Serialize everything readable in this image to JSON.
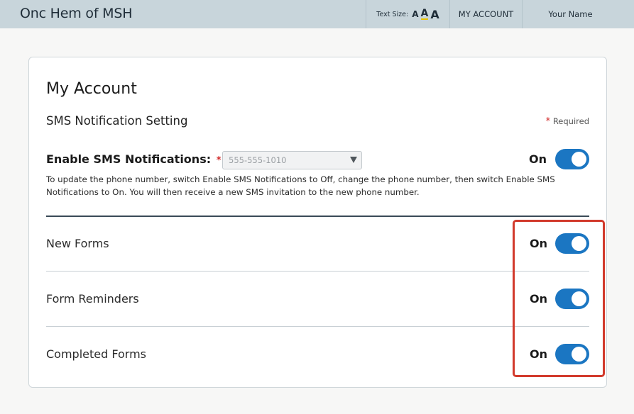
{
  "header": {
    "app_title": "Onc Hem of MSH",
    "text_size_label": "Text Size:",
    "text_size_small": "A",
    "text_size_medium": "A",
    "text_size_large": "A",
    "my_account": "MY ACCOUNT",
    "user_name": "Your Name"
  },
  "page": {
    "title": "My Account",
    "section_title": "SMS Notification Setting",
    "required_star": "*",
    "required_label": "Required"
  },
  "sms": {
    "enable_label": "Enable SMS Notifications:",
    "enable_star": "*",
    "phone_value": "555-555-1010",
    "state_label": "On",
    "enabled": true,
    "help_text": "To update the phone number, switch Enable SMS Notifications to Off, change the phone number, then switch Enable SMS Notifications to On. You will then receive a new SMS invitation to the new phone number."
  },
  "preferences": [
    {
      "label": "New Forms",
      "state_label": "On",
      "enabled": true
    },
    {
      "label": "Form Reminders",
      "state_label": "On",
      "enabled": true
    },
    {
      "label": "Completed Forms",
      "state_label": "On",
      "enabled": true
    }
  ],
  "colors": {
    "header_bg": "#c8d5db",
    "toggle_on": "#1b76c2",
    "highlight": "#d23a2c",
    "required_star": "#d22a2a"
  }
}
